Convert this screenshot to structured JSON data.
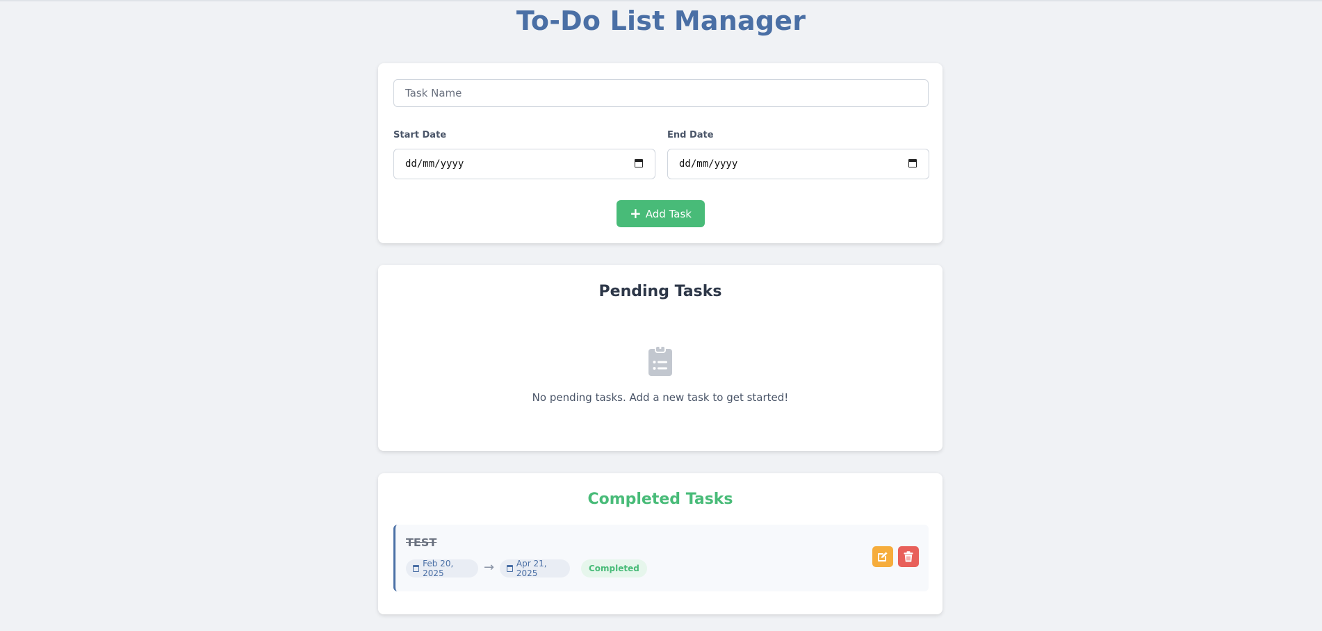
{
  "app": {
    "title": "To-Do List Manager"
  },
  "form": {
    "task_placeholder": "Task Name",
    "start_label": "Start Date",
    "end_label": "End Date",
    "start_value": "dd/mm/yyyy",
    "end_value": "dd/mm/yyyy",
    "add_button_label": "Add Task"
  },
  "pending": {
    "title": "Pending Tasks",
    "empty_message": "No pending tasks. Add a new task to get started!",
    "empty_icon": "clipboard-list-icon"
  },
  "completed": {
    "title": "Completed Tasks",
    "tasks": [
      {
        "name": "TEST",
        "start_date": "Feb 20, 2025",
        "end_date": "Apr 21, 2025",
        "status": "Completed"
      }
    ]
  },
  "colors": {
    "primary": "#4a6fa5",
    "success": "#48bb78",
    "warning": "#f6ad3c",
    "danger": "#e8605a",
    "background": "#f0f2f5"
  }
}
